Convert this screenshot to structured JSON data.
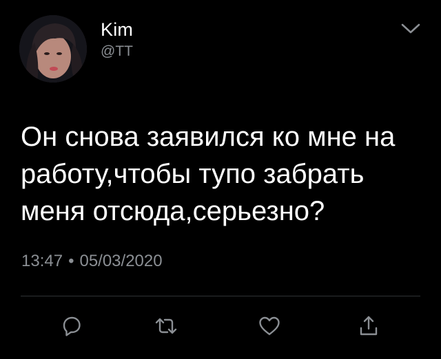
{
  "tweet": {
    "author": {
      "display_name": "Kim",
      "handle": "@TT",
      "avatar_icon": "profile-photo"
    },
    "text_lines": [
      "Он снова заявился ко мне на",
      "работу,чтобы тупо забрать",
      "меня отсюда,серьезно?"
    ],
    "time": "13:47",
    "separator": "•",
    "date": "05/03/2020",
    "actions": [
      {
        "icon": "reply-icon"
      },
      {
        "icon": "retweet-icon"
      },
      {
        "icon": "like-icon"
      },
      {
        "icon": "share-icon"
      }
    ],
    "menu_icon": "chevron-down-icon"
  },
  "colors": {
    "background": "#000000",
    "text_primary": "#ffffff",
    "text_secondary": "#8b8f94",
    "divider": "#2f3336"
  }
}
